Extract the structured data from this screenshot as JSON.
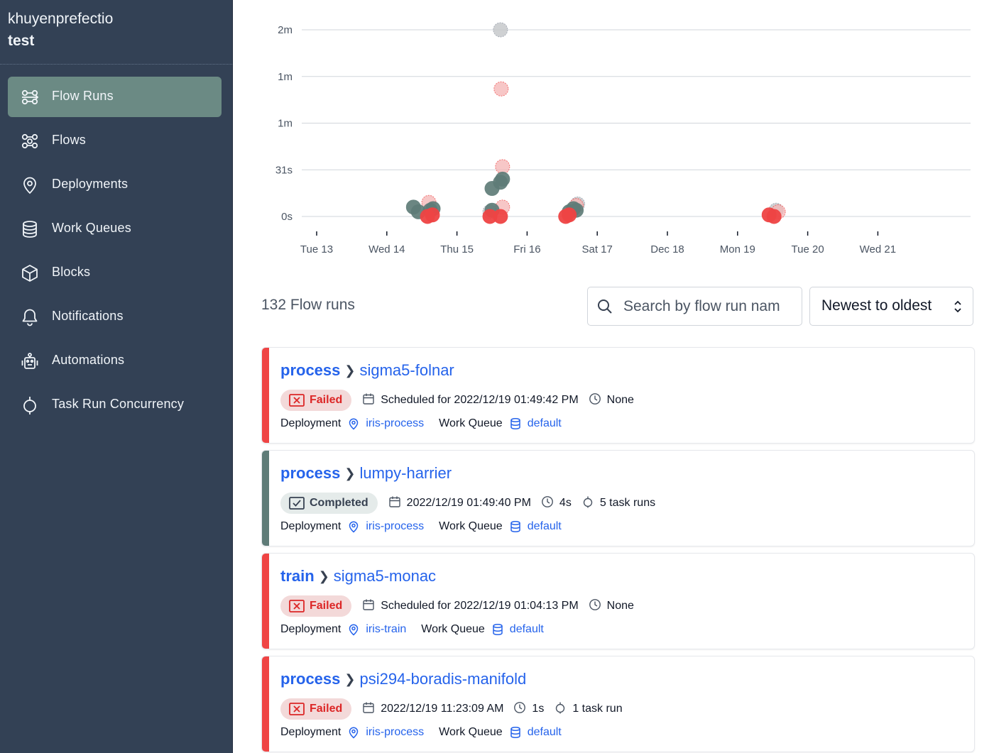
{
  "workspace": {
    "name": "khuyenprefectio",
    "env": "test"
  },
  "sidebar": {
    "items": [
      {
        "label": "Flow Runs",
        "icon": "flow-runs-icon",
        "active": true
      },
      {
        "label": "Flows",
        "icon": "flows-icon",
        "active": false
      },
      {
        "label": "Deployments",
        "icon": "map-pin-icon",
        "active": false
      },
      {
        "label": "Work Queues",
        "icon": "database-icon",
        "active": false
      },
      {
        "label": "Blocks",
        "icon": "cube-icon",
        "active": false
      },
      {
        "label": "Notifications",
        "icon": "bell-icon",
        "active": false
      },
      {
        "label": "Automations",
        "icon": "robot-icon",
        "active": false
      },
      {
        "label": "Task Run Concurrency",
        "icon": "concurrency-icon",
        "active": false
      }
    ]
  },
  "chart_data": {
    "type": "scatter",
    "x_tick_labels": [
      "Tue 13",
      "Wed 14",
      "Thu 15",
      "Fri 16",
      "Sat 17",
      "Dec 18",
      "Mon 19",
      "Tue 20",
      "Wed 21"
    ],
    "y_tick_labels": [
      "2m",
      "1m",
      "1m",
      "31s",
      "0s"
    ],
    "y_tick_values_seconds": [
      120,
      90,
      60,
      30,
      0
    ],
    "y_axis_unit": "seconds",
    "x_axis_unit": "days from Tue 13",
    "colors": {
      "completed": "#5f7c78",
      "failed": "#ef4444",
      "scheduled": "#9ca3af"
    },
    "series": [
      {
        "state": "completed",
        "points": [
          [
            1.38,
            6
          ],
          [
            1.45,
            3
          ],
          [
            1.62,
            4
          ],
          [
            1.66,
            5
          ],
          [
            2.5,
            4
          ],
          [
            2.5,
            18
          ],
          [
            2.62,
            22
          ],
          [
            2.65,
            24
          ],
          [
            3.6,
            3
          ],
          [
            3.66,
            5
          ],
          [
            3.7,
            4
          ]
        ]
      },
      {
        "state": "failed",
        "points": [
          [
            1.58,
            0
          ],
          [
            1.65,
            1
          ],
          [
            2.47,
            0
          ],
          [
            2.62,
            0
          ],
          [
            3.55,
            0
          ],
          [
            3.6,
            1
          ],
          [
            6.45,
            1
          ],
          [
            6.52,
            0
          ]
        ]
      },
      {
        "state": "failed-outline",
        "points": [
          [
            1.6,
            9
          ],
          [
            2.63,
            82
          ],
          [
            2.65,
            32
          ],
          [
            2.65,
            6
          ],
          [
            3.7,
            7
          ],
          [
            6.58,
            3
          ]
        ]
      },
      {
        "state": "scheduled",
        "points": [
          [
            2.62,
            120
          ],
          [
            2.47,
            3
          ],
          [
            3.72,
            8
          ],
          [
            6.55,
            4
          ]
        ]
      }
    ]
  },
  "runs_count": "132 Flow runs",
  "search": {
    "placeholder": "Search by flow run name"
  },
  "sort": {
    "label": "Newest to oldest"
  },
  "runs": [
    {
      "flow": "process",
      "name": "sigma5-folnar",
      "state": "Failed",
      "state_key": "failed",
      "time": "Scheduled for 2022/12/19 01:49:42 PM",
      "duration": "None",
      "task_runs": "",
      "deployment_label": "Deployment",
      "deployment": "iris-process",
      "work_queue_label": "Work Queue",
      "work_queue": "default",
      "accent": "#ef4444"
    },
    {
      "flow": "process",
      "name": "lumpy-harrier",
      "state": "Completed",
      "state_key": "completed",
      "time": "2022/12/19 01:49:40 PM",
      "duration": "4s",
      "task_runs": "5 task runs",
      "deployment_label": "Deployment",
      "deployment": "iris-process",
      "work_queue_label": "Work Queue",
      "work_queue": "default",
      "accent": "#5f7c78"
    },
    {
      "flow": "train",
      "name": "sigma5-monac",
      "state": "Failed",
      "state_key": "failed",
      "time": "Scheduled for 2022/12/19 01:04:13 PM",
      "duration": "None",
      "task_runs": "",
      "deployment_label": "Deployment",
      "deployment": "iris-train",
      "work_queue_label": "Work Queue",
      "work_queue": "default",
      "accent": "#ef4444"
    },
    {
      "flow": "process",
      "name": "psi294-boradis-manifold",
      "state": "Failed",
      "state_key": "failed",
      "time": "2022/12/19 11:23:09 AM",
      "duration": "1s",
      "task_runs": "1 task run",
      "deployment_label": "Deployment",
      "deployment": "iris-process",
      "work_queue_label": "Work Queue",
      "work_queue": "default",
      "accent": "#ef4444"
    }
  ]
}
